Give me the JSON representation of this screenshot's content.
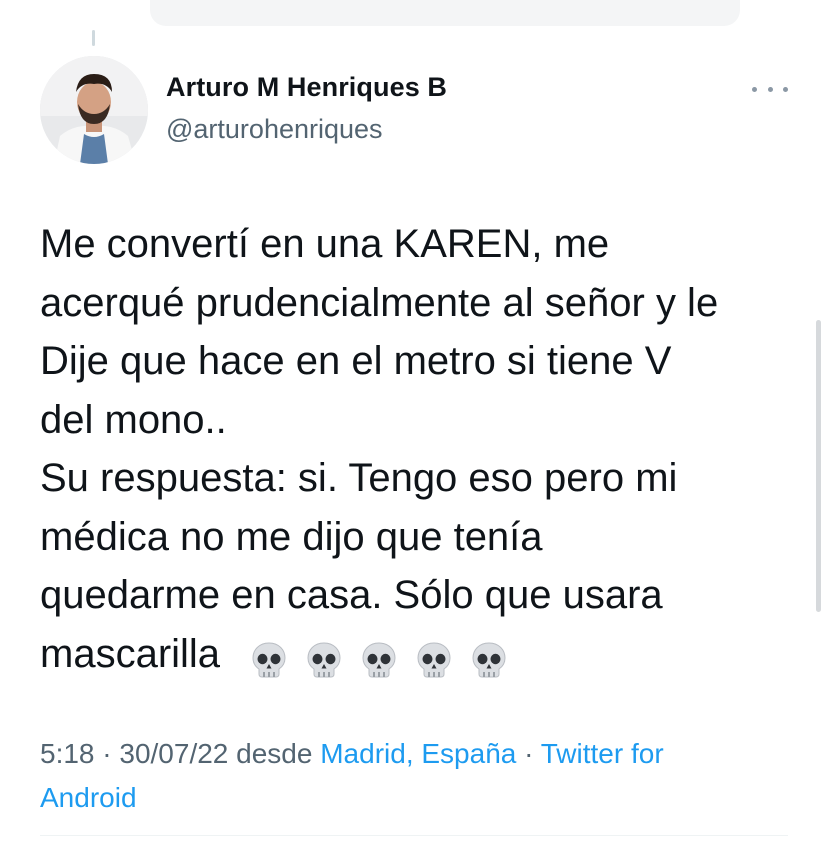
{
  "tweet": {
    "author_name": "Arturo M Henriques B",
    "author_handle": "@arturohenriques",
    "text_lines": [
      "Me convertí en una KAREN, me",
      "acerqué prudencialmente al señor y le",
      "Dije que hace en el metro si tiene V",
      "del mono..",
      "Su respuesta: si. Tengo eso pero mi",
      "médica no me dijo que tenía",
      "quedarme en casa. Sólo que usara",
      "mascarilla"
    ],
    "emoji": [
      "💀",
      "💀",
      "💀",
      "💀",
      "💀"
    ],
    "timestamp": "5:18 · 30/07/22",
    "desde": "desde",
    "location": "Madrid, España",
    "separator": "·",
    "client_line1": "Twitter for",
    "client_line2": "Android"
  },
  "icons": {
    "more": "more-horizontal-icon",
    "emoji": "skull-emoji"
  },
  "colors": {
    "text": "#0f1419",
    "secondary": "#536471",
    "link": "#1d9bf0",
    "divider": "#eff3f4"
  }
}
